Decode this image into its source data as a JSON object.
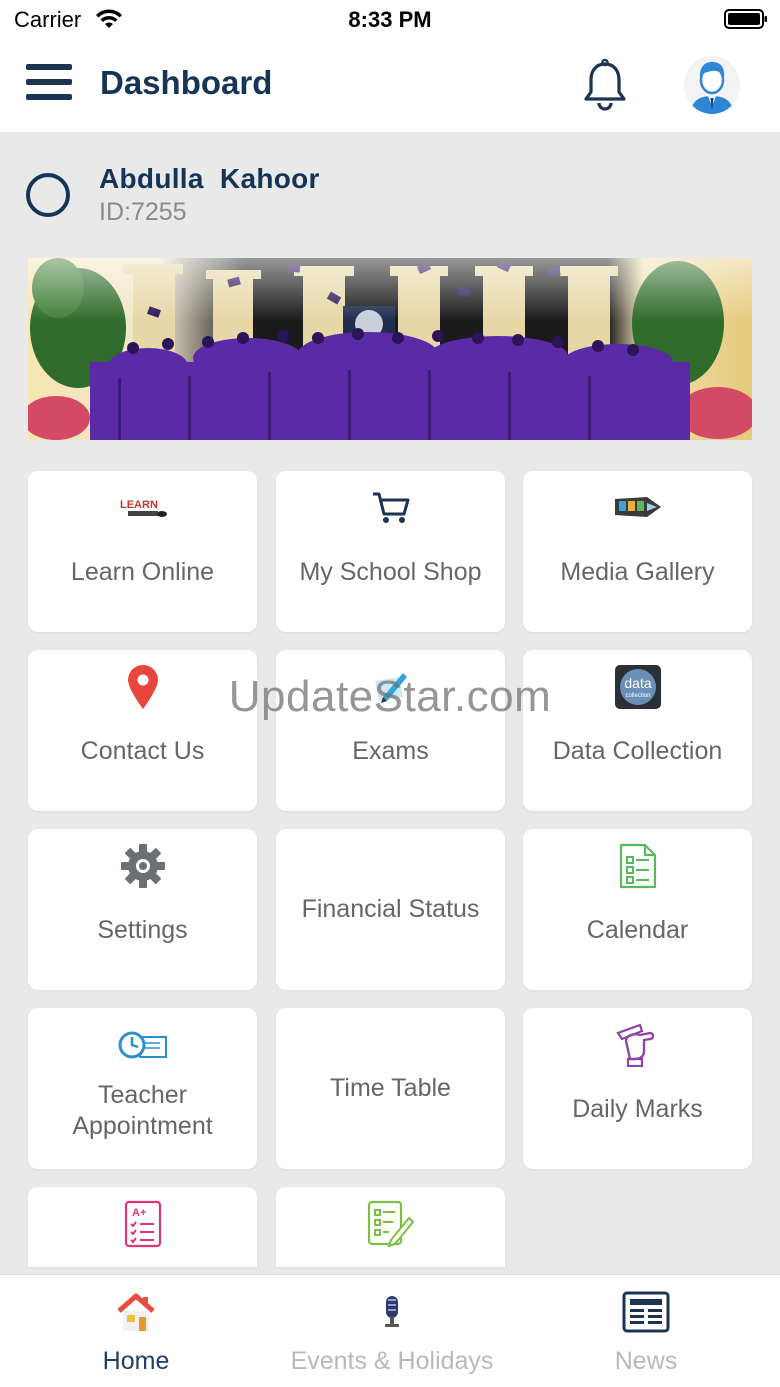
{
  "status_bar": {
    "carrier": "Carrier",
    "time": "8:33 PM"
  },
  "header": {
    "title": "Dashboard"
  },
  "user": {
    "name": "Abdulla  Kahoor",
    "id": "ID:7255"
  },
  "tiles": [
    {
      "label": "Learn Online",
      "icon": "learn-icon"
    },
    {
      "label": "My School Shop",
      "icon": "cart-icon"
    },
    {
      "label": "Media Gallery",
      "icon": "film-icon"
    },
    {
      "label": "Contact Us",
      "icon": "location-pin-icon"
    },
    {
      "label": "Exams",
      "icon": "exam-pen-icon"
    },
    {
      "label": "Data Collection",
      "icon": "data-icon"
    },
    {
      "label": "Settings",
      "icon": "gear-icon"
    },
    {
      "label": "Financial Status",
      "icon": ""
    },
    {
      "label": "Calendar",
      "icon": "checklist-icon"
    },
    {
      "label": "Teacher Appointment",
      "label_lines": [
        "Teacher",
        "Appointment"
      ],
      "icon": "clock-note-icon"
    },
    {
      "label": "Time Table",
      "icon": ""
    },
    {
      "label": "Daily Marks",
      "icon": "hand-pen-icon"
    },
    {
      "label": "",
      "icon": "grade-sheet-icon"
    },
    {
      "label": "",
      "icon": "form-pen-icon"
    }
  ],
  "watermark": "UpdateStar.com",
  "tab_bar": {
    "home": "Home",
    "events": "Events & Holidays",
    "news": "News"
  },
  "colors": {
    "primary": "#163556",
    "inactive": "#b9b9b9",
    "tile_text": "#666666",
    "background": "#e9e9e9"
  }
}
